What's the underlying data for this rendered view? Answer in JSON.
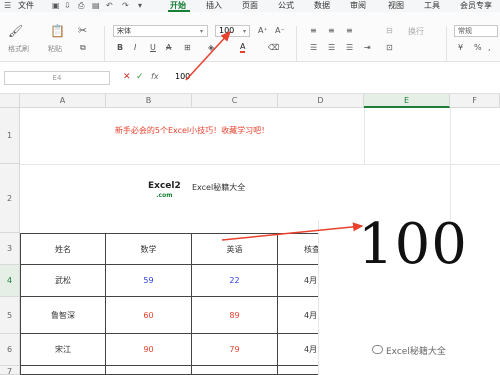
{
  "menubar": {
    "file": "文件",
    "tabs": [
      "开始",
      "插入",
      "页面",
      "公式",
      "数据",
      "审阅",
      "视图",
      "工具",
      "会员专享"
    ],
    "active_tab": "开始"
  },
  "ribbon": {
    "format_painter": "格式刷",
    "paste": "粘贴",
    "font_name": "宋体",
    "font_size": "100",
    "wrap": "换行",
    "number_format": "常规",
    "font_color": "#e8412c",
    "accent": "#1a7f37"
  },
  "formula_bar": {
    "cell_ref": "E4",
    "value": "100"
  },
  "columns": [
    "A",
    "B",
    "C",
    "D",
    "E",
    "F"
  ],
  "rows": [
    "1",
    "2",
    "3",
    "4",
    "5",
    "6",
    "7"
  ],
  "sheet": {
    "title": "新手必会的5个Excel小技巧！收藏学习吧！",
    "logo_main": "Excel2",
    "logo_sub": ".com",
    "logo_text": "Excel秘籍大全",
    "headers": [
      "姓名",
      "数学",
      "英语",
      "核查"
    ],
    "data": [
      {
        "name": "武松",
        "math": "59",
        "english": "22",
        "check": "4月"
      },
      {
        "name": "鲁智深",
        "math": "60",
        "english": "89",
        "check": "4月"
      },
      {
        "name": "宋江",
        "math": "90",
        "english": "79",
        "check": "4月"
      }
    ],
    "overlay_value": "100"
  },
  "watermark": "Excel秘籍大全"
}
